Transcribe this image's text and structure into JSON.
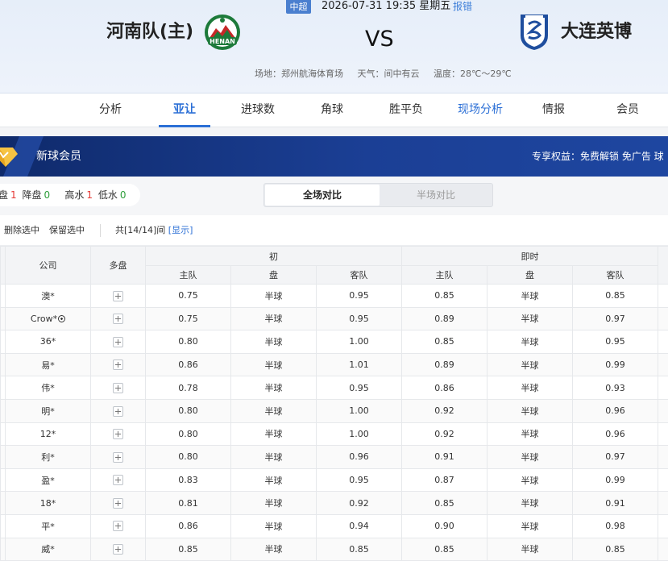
{
  "match": {
    "league": "中超",
    "kickoff": "2026-07-31 19:35 星期五",
    "report_label": "报错",
    "home_team": "河南队(主)",
    "away_team": "大连英博",
    "vs": "VS",
    "home_logo_text": "HENAN",
    "venue": "场地：郑州航海体育场",
    "weather": "天气：间中有云",
    "temperature": "温度：28℃～29℃"
  },
  "tabs": [
    {
      "label": "分析"
    },
    {
      "label": "亚让",
      "active": true
    },
    {
      "label": "进球数"
    },
    {
      "label": "角球"
    },
    {
      "label": "胜平负"
    },
    {
      "label": "现场分析"
    },
    {
      "label": "情报"
    },
    {
      "label": "会员"
    }
  ],
  "banner": {
    "title": "新球会员",
    "perks": "专享权益：免费解锁 免广告 球"
  },
  "stats": {
    "a_label": "盘",
    "a_value": "1",
    "b_label": "降盘",
    "b_value": "0",
    "c_label": "高水",
    "c_value": "1",
    "d_label": "低水",
    "d_value": "0"
  },
  "segment": {
    "full": "全场对比",
    "half": "半场对比"
  },
  "actions": {
    "delete_selected": "删除选中",
    "keep_selected": "保留选中",
    "count_text": "共[14/14]间",
    "show_link": "[显示]"
  },
  "table": {
    "col_company": "公司",
    "col_multi": "多盘",
    "group_initial": "初",
    "group_live": "即时",
    "sub_home": "主队",
    "sub_line": "盘",
    "sub_away": "客队",
    "rows": [
      {
        "company": "澳*",
        "ball": false,
        "ih": "0.75",
        "il": "半球",
        "ia": "0.95",
        "lh": "0.85",
        "ll": "半球",
        "la": "0.85"
      },
      {
        "company": "Crow*",
        "ball": true,
        "ih": "0.75",
        "il": "半球",
        "ia": "0.95",
        "lh": "0.89",
        "ll": "半球",
        "la": "0.97"
      },
      {
        "company": "36*",
        "ball": false,
        "ih": "0.80",
        "il": "半球",
        "ia": "1.00",
        "lh": "0.85",
        "ll": "半球",
        "la": "0.95"
      },
      {
        "company": "易*",
        "ball": false,
        "ih": "0.86",
        "il": "半球",
        "ia": "1.01",
        "lh": "0.89",
        "ll": "半球",
        "la": "0.99"
      },
      {
        "company": "伟*",
        "ball": false,
        "ih": "0.78",
        "il": "半球",
        "ia": "0.95",
        "lh": "0.86",
        "ll": "半球",
        "la": "0.93"
      },
      {
        "company": "明*",
        "ball": false,
        "ih": "0.80",
        "il": "半球",
        "ia": "1.00",
        "lh": "0.92",
        "ll": "半球",
        "la": "0.96"
      },
      {
        "company": "12*",
        "ball": false,
        "ih": "0.80",
        "il": "半球",
        "ia": "1.00",
        "lh": "0.92",
        "ll": "半球",
        "la": "0.96"
      },
      {
        "company": "利*",
        "ball": false,
        "ih": "0.80",
        "il": "半球",
        "ia": "0.96",
        "lh": "0.91",
        "ll": "半球",
        "la": "0.97"
      },
      {
        "company": "盈*",
        "ball": false,
        "ih": "0.83",
        "il": "半球",
        "ia": "0.95",
        "lh": "0.87",
        "ll": "半球",
        "la": "0.99"
      },
      {
        "company": "18*",
        "ball": false,
        "ih": "0.81",
        "il": "半球",
        "ia": "0.92",
        "lh": "0.85",
        "ll": "半球",
        "la": "0.91"
      },
      {
        "company": "平*",
        "ball": false,
        "ih": "0.86",
        "il": "半球",
        "ia": "0.94",
        "lh": "0.90",
        "ll": "半球",
        "la": "0.98"
      },
      {
        "company": "威*",
        "ball": false,
        "ih": "0.85",
        "il": "半球",
        "ia": "0.85",
        "lh": "0.85",
        "ll": "半球",
        "la": "0.85"
      }
    ]
  },
  "colors": {
    "accent": "#2b6fd6",
    "league_badge": "#4a7fcf",
    "banner": "#1b3f95",
    "up": "#e53935",
    "down": "#2e9e3b"
  }
}
